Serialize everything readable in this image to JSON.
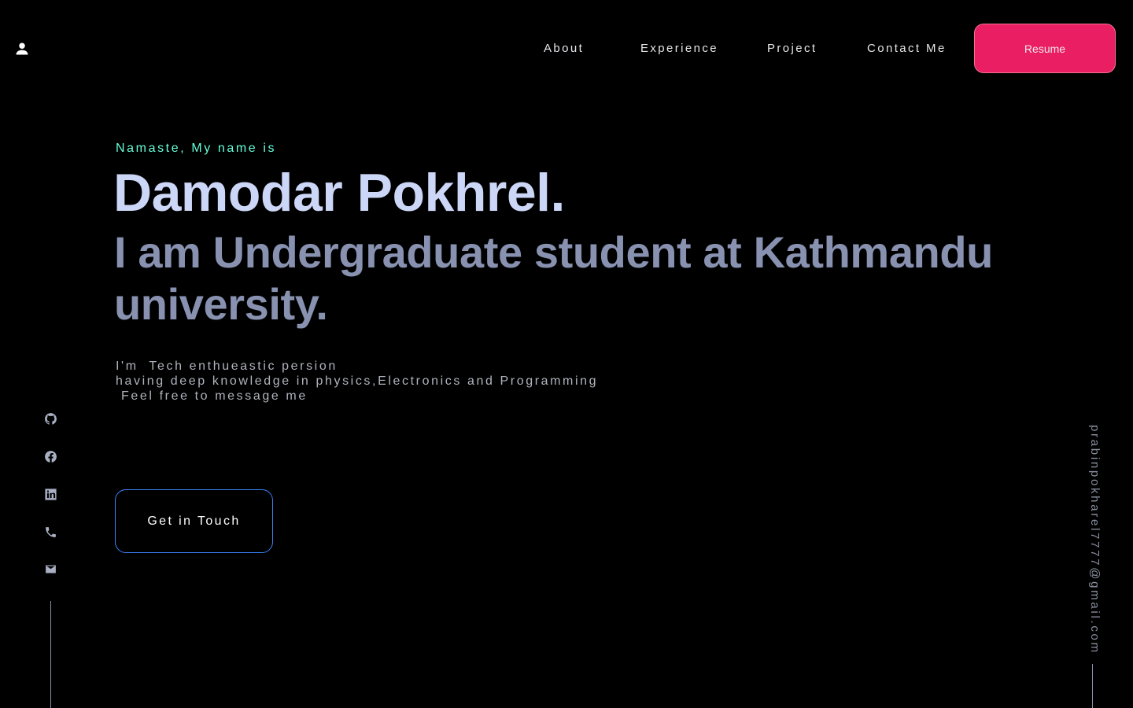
{
  "header": {
    "logo_icon": "person-icon",
    "nav": [
      {
        "label": "About"
      },
      {
        "label": "Experience"
      },
      {
        "label": "Project"
      },
      {
        "label": "Contact Me"
      }
    ],
    "resume_label": "Resume"
  },
  "hero": {
    "greeting": "Namaste, My name is",
    "name": "Damodar Pokhrel.",
    "tagline": "I am Undergraduate student at Kathmandu university.",
    "bio_lines": [
      "I'm  Tech enthueastic persion",
      "having deep knowledge in physics,Electronics and Programming",
      " Feel free to message me"
    ],
    "cta_label": "Get in Touch"
  },
  "socials": [
    {
      "icon": "github-icon"
    },
    {
      "icon": "facebook-icon"
    },
    {
      "icon": "linkedin-icon"
    },
    {
      "icon": "phone-icon"
    },
    {
      "icon": "email-icon"
    }
  ],
  "email": "prabinpokharel7777@gmail.com",
  "colors": {
    "background": "#000000",
    "accent_green": "#64ffda",
    "name_color": "#ccd6f6",
    "tagline_color": "#8892b0",
    "resume_bg": "#e91e63",
    "cta_border": "#3b82f6"
  }
}
